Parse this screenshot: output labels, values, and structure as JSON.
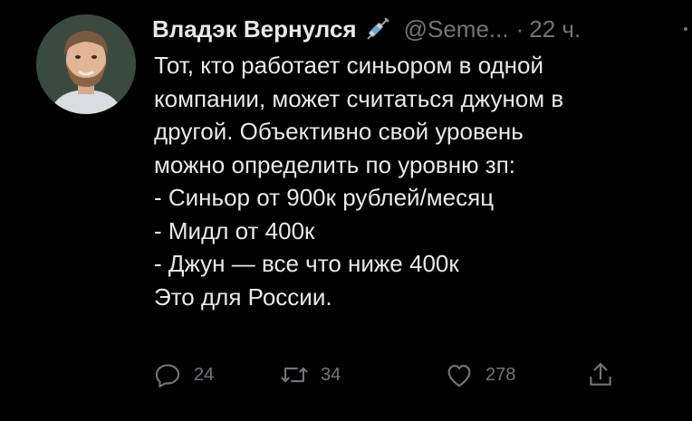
{
  "tweet": {
    "author_name": "Владэк Вернулся",
    "author_handle": "@Seme...",
    "separator": "·",
    "time_ago": "22 ч.",
    "badge_icon": "syringe-icon",
    "text_lines": [
      "Тот, кто работает синьором в одной",
      "компании, может считаться джуном в",
      "другой. Объективно свой уровень",
      "можно определить по уровню зп:",
      "- Синьор от 900к рублей/месяц",
      "- Мидл от 400к",
      "- Джун — все что ниже 400к",
      "Это для России."
    ],
    "actions": {
      "reply_count": "24",
      "retweet_count": "34",
      "like_count": "278",
      "reply_icon": "reply-icon",
      "retweet_icon": "retweet-icon",
      "like_icon": "heart-icon",
      "share_icon": "share-icon"
    }
  },
  "colors": {
    "background": "#000000",
    "primary_text": "#e7e9ea",
    "secondary_text": "#71767b"
  }
}
